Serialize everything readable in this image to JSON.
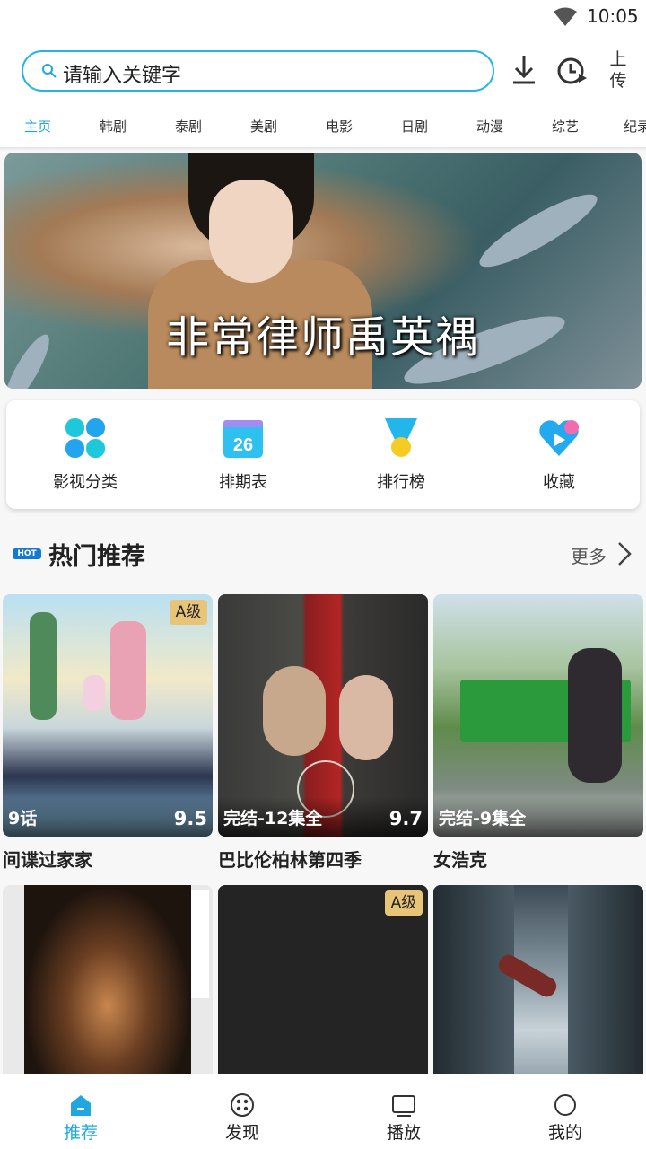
{
  "status_bar": {
    "time": "10:05"
  },
  "search": {
    "placeholder": "请输入关键字"
  },
  "top_actions": {
    "upload_label": "上传"
  },
  "category_tabs": [
    "主页",
    "韩剧",
    "泰剧",
    "美剧",
    "电影",
    "日剧",
    "动漫",
    "综艺",
    "纪录"
  ],
  "banner": {
    "title": "非常律师禹英禑"
  },
  "quick_links": [
    "影视分类",
    "排期表",
    "排行榜",
    "收藏"
  ],
  "calendar_day": "26",
  "section": {
    "badge": "HOT",
    "title": "热门推荐",
    "more": "更多"
  },
  "cards": [
    {
      "title": "间谍过家家",
      "episodes": "9话",
      "score": "9.5",
      "badge": "A级"
    },
    {
      "title": "巴比伦柏林第四季",
      "episodes": "完结-12集全",
      "score": "9.7"
    },
    {
      "title": "女浩克",
      "episodes": "完结-9集全"
    },
    {
      "title": ""
    },
    {
      "title": "",
      "badge": "A级"
    },
    {
      "title": ""
    }
  ],
  "bottom_nav": [
    "推荐",
    "发现",
    "播放",
    "我的"
  ],
  "colors": {
    "accent": "#1fa8e0",
    "badge_gold": "#e7c477"
  }
}
